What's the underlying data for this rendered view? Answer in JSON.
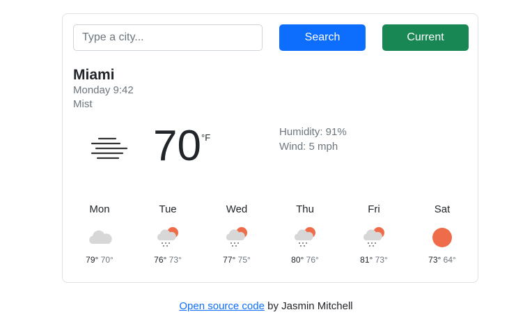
{
  "search": {
    "placeholder": "Type a city...",
    "value": ""
  },
  "buttons": {
    "search_label": "Search",
    "current_label": "Current"
  },
  "current": {
    "city": "Miami",
    "date": "Monday 9:42",
    "description": "Mist",
    "icon": "mist-icon",
    "temperature": "70",
    "unit": "°F",
    "humidity": "Humidity: 91%",
    "wind": "Wind: 5 mph"
  },
  "forecast": [
    {
      "day": "Mon",
      "icon": "cloud-icon",
      "high": "79°",
      "low": "70°"
    },
    {
      "day": "Tue",
      "icon": "rain-sun-icon",
      "high": "76°",
      "low": "73°"
    },
    {
      "day": "Wed",
      "icon": "rain-sun-icon",
      "high": "77°",
      "low": "75°"
    },
    {
      "day": "Thu",
      "icon": "rain-sun-icon",
      "high": "80°",
      "low": "76°"
    },
    {
      "day": "Fri",
      "icon": "rain-sun-icon",
      "high": "81°",
      "low": "73°"
    },
    {
      "day": "Sat",
      "icon": "sun-icon",
      "high": "73°",
      "low": "64°"
    }
  ],
  "footer": {
    "link_text": "Open source code",
    "byline": " by Jasmin Mitchell"
  },
  "colors": {
    "primary": "#0d6efd",
    "success": "#198754",
    "sun": "#ef6c4a",
    "cloud": "#d7d7d7"
  }
}
